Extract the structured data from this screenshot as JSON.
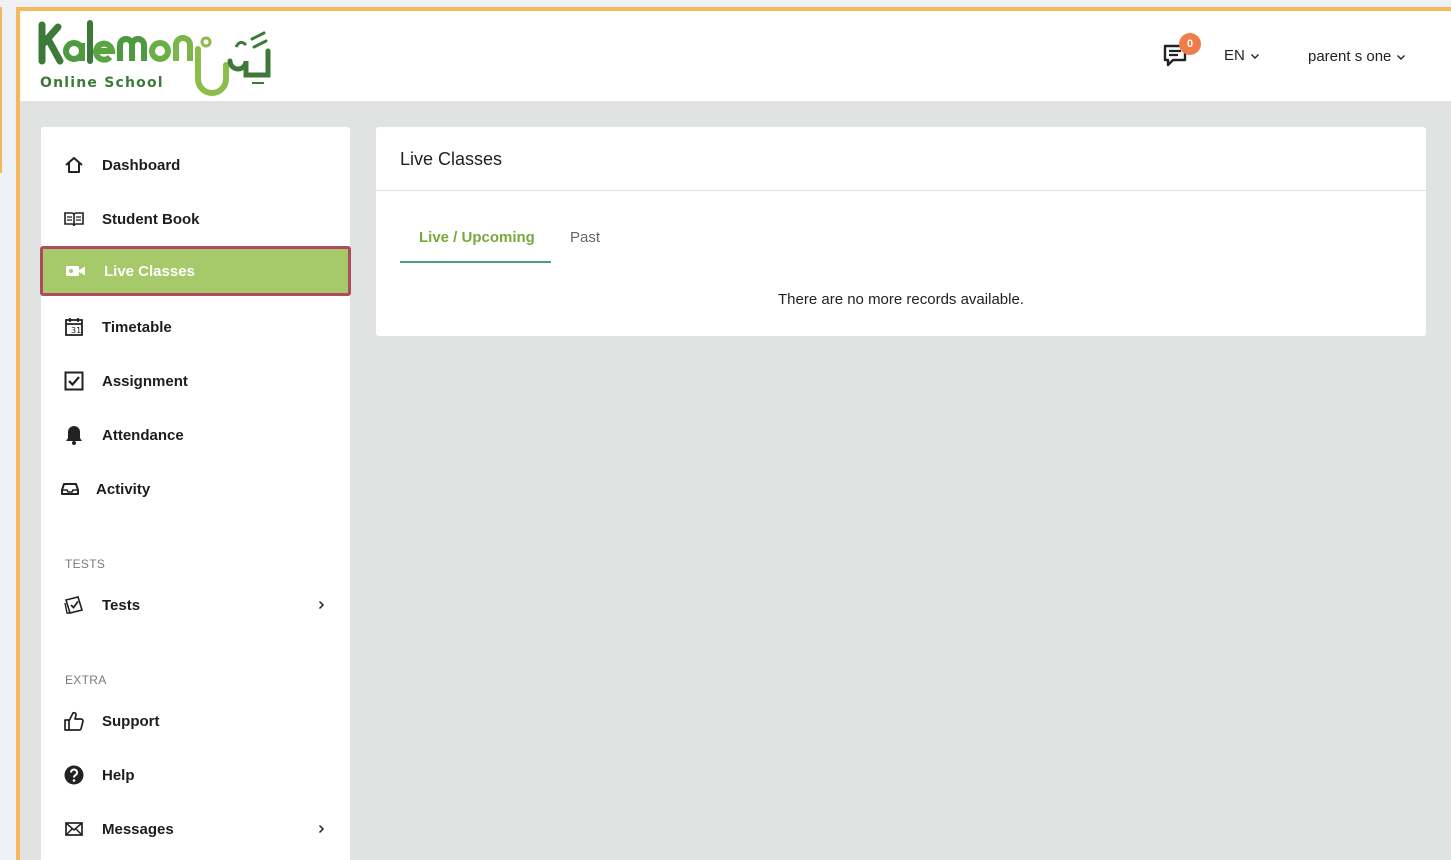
{
  "logo": {
    "wordmark": "Kalemon",
    "subtitle": "Online School"
  },
  "header": {
    "messages_count": "0",
    "language": "EN",
    "user_name": "parent s one"
  },
  "sidebar": {
    "items": [
      {
        "label": "Dashboard",
        "icon": "home-icon"
      },
      {
        "label": "Student Book",
        "icon": "book-icon"
      },
      {
        "label": "Live Classes",
        "icon": "video-camera-icon",
        "active": true
      },
      {
        "label": "Timetable",
        "icon": "calendar-icon"
      },
      {
        "label": "Assignment",
        "icon": "checkbox-icon"
      },
      {
        "label": "Attendance",
        "icon": "bell-icon"
      },
      {
        "label": "Activity",
        "icon": "inbox-icon"
      }
    ],
    "sections": {
      "tests": {
        "title": "TESTS",
        "items": [
          {
            "label": "Tests",
            "icon": "clipboard-check-icon"
          }
        ]
      },
      "extra": {
        "title": "EXTRA",
        "items": [
          {
            "label": "Support",
            "icon": "thumbs-up-icon"
          },
          {
            "label": "Help",
            "icon": "question-circle-icon"
          },
          {
            "label": "Messages",
            "icon": "envelope-icon"
          }
        ]
      }
    }
  },
  "main": {
    "title": "Live Classes",
    "tabs": [
      {
        "label": "Live / Upcoming",
        "active": true
      },
      {
        "label": "Past",
        "active": false
      }
    ],
    "empty_message": "There are no more records available."
  },
  "colors": {
    "frame_border": "#f6b85a",
    "active_bg": "#a6c96a",
    "active_border": "#b04a5f",
    "tab_active": "#7aa83a",
    "tab_underline": "#4a9e8e",
    "badge": "#ef7d4c"
  }
}
